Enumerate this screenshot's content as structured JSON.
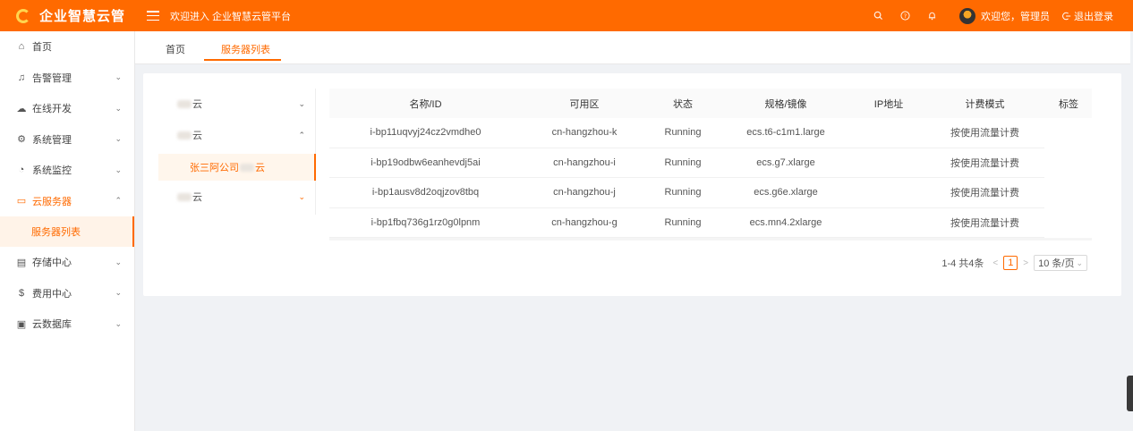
{
  "brand": {
    "title": "企业智慧云管"
  },
  "header": {
    "welcome": "欢迎进入 企业智慧云管平台",
    "greeting": "欢迎您，管理员",
    "logout": "退出登录"
  },
  "sidebar": {
    "items": [
      {
        "label": "首页",
        "icon": "home-icon"
      },
      {
        "label": "告警管理",
        "icon": "bell-icon"
      },
      {
        "label": "在线开发",
        "icon": "cloud-icon"
      },
      {
        "label": "系统管理",
        "icon": "gear-icon"
      },
      {
        "label": "系统监控",
        "icon": "gauge-icon"
      },
      {
        "label": "云服务器",
        "icon": "monitor-icon"
      },
      {
        "label": "服务器列表"
      },
      {
        "label": "存储中心",
        "icon": "storage-icon"
      },
      {
        "label": "费用中心",
        "icon": "dollar-icon"
      },
      {
        "label": "云数据库",
        "icon": "database-icon"
      }
    ]
  },
  "tabs": [
    {
      "label": "首页"
    },
    {
      "label": "服务器列表"
    }
  ],
  "tree": {
    "nodes": [
      {
        "suffix": "云"
      },
      {
        "suffix": "云"
      },
      {
        "prefix": "张三阿公司",
        "suffix": "云"
      },
      {
        "suffix": "云"
      }
    ]
  },
  "table": {
    "headers": [
      "名称/ID",
      "可用区",
      "状态",
      "规格/镜像",
      "IP地址",
      "计费模式",
      "标签"
    ],
    "rows": [
      {
        "id": "i-bp11uqvyj24cz2vmdhe0",
        "zone": "cn-hangzhou-k",
        "status": "Running",
        "spec": "ecs.t6-c1m1.large",
        "ip": "",
        "billing": "按使用流量计费"
      },
      {
        "id": "i-bp19odbw6eanhevdj5ai",
        "zone": "cn-hangzhou-i",
        "status": "Running",
        "spec": "ecs.g7.xlarge",
        "ip": "",
        "billing": "按使用流量计费"
      },
      {
        "id": "i-bp1ausv8d2oqjzov8tbq",
        "zone": "cn-hangzhou-j",
        "status": "Running",
        "spec": "ecs.g6e.xlarge",
        "ip": "",
        "billing": "按使用流量计费"
      },
      {
        "id": "i-bp1fbq736g1rz0g0lpnm",
        "zone": "cn-hangzhou-g",
        "status": "Running",
        "spec": "ecs.mn4.2xlarge",
        "ip": "",
        "billing": "按使用流量计费"
      }
    ]
  },
  "pagination": {
    "summary": "1-4 共4条",
    "current_page": "1",
    "page_size": "10 条/页"
  },
  "colors": {
    "accent": "#ff6a00"
  }
}
